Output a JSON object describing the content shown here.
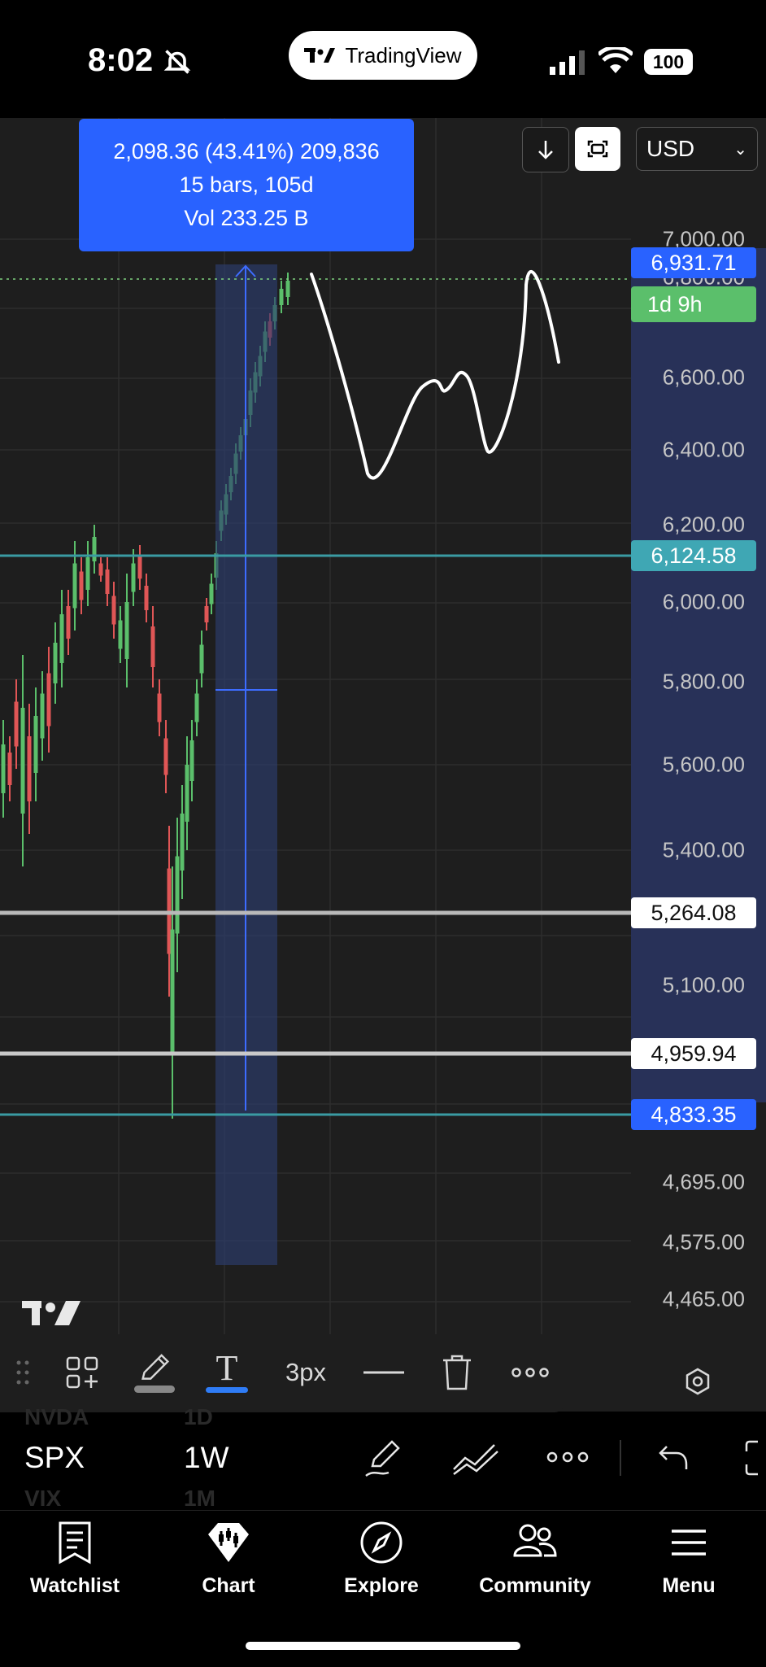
{
  "status_bar": {
    "time": "8:02",
    "app_pill": "TradingView",
    "battery": "100"
  },
  "chart": {
    "top_buttons": {
      "currency": "USD"
    },
    "measurement": {
      "line1": "2,098.36 (43.41%) 209,836",
      "line2": "15 bars, 105d",
      "line3": "Vol 233.25 B"
    },
    "price_ticks": [
      "7,000.00",
      "6,800.00",
      "6,600.00",
      "6,400.00",
      "6,200.00",
      "6,000.00",
      "5,800.00",
      "5,600.00",
      "5,400.00",
      "5,100.00",
      "4,695.00",
      "4,575.00",
      "4,465.00"
    ],
    "price_tags": {
      "last_price": "6,931.71",
      "countdown": "1d 9h",
      "level_1": "6,124.58",
      "level_2": "5,264.08",
      "level_3": "4,959.94",
      "level_4": "4,833.35"
    },
    "colors": {
      "background": "#1e1e1e",
      "up": "#5bbf6b",
      "down": "#e05656",
      "measure": "#2962ff",
      "level": "#3a9ba3"
    }
  },
  "drawing_toolbar": {
    "stroke_width": "3px",
    "icons": [
      "drag-handle-icon",
      "add-object-icon",
      "pencil-icon",
      "text-tool-icon",
      "line-style-icon",
      "trash-icon",
      "more-icon"
    ]
  },
  "symbol_bar": {
    "symbol": "SPX",
    "interval": "1W",
    "ghost_symbol_above": "NVDA",
    "ghost_interval_above": "1D",
    "ghost_symbol_below": "VIX",
    "ghost_interval_below": "1M"
  },
  "bottom_nav": [
    {
      "label": "Watchlist",
      "icon": "watchlist-icon"
    },
    {
      "label": "Chart",
      "icon": "chart-icon"
    },
    {
      "label": "Explore",
      "icon": "compass-icon"
    },
    {
      "label": "Community",
      "icon": "community-icon"
    },
    {
      "label": "Menu",
      "icon": "menu-icon"
    }
  ]
}
